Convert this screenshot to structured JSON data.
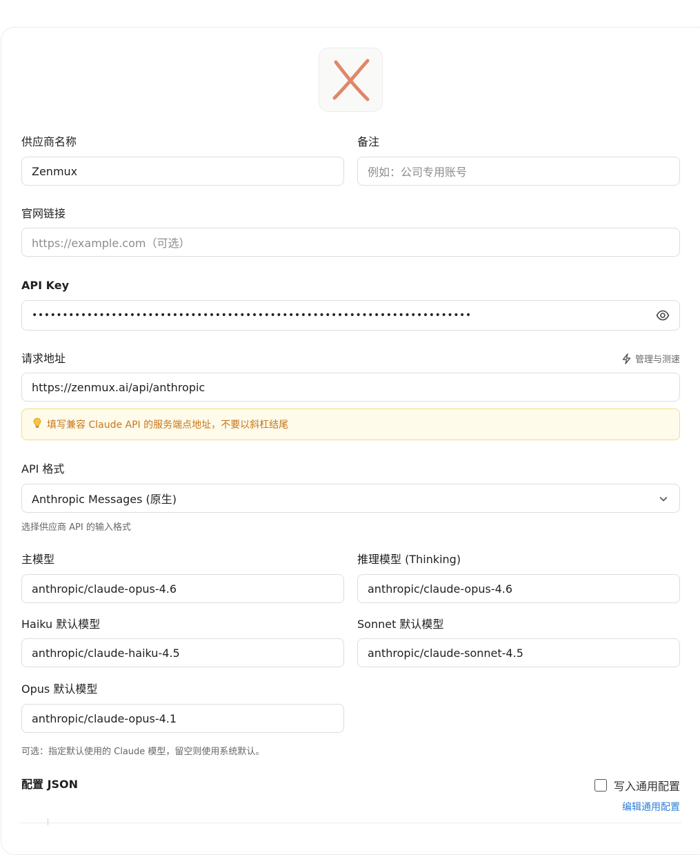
{
  "provider_name": {
    "label": "供应商名称",
    "value": "Zenmux"
  },
  "note": {
    "label": "备注",
    "placeholder": "例如：公司专用账号"
  },
  "website": {
    "label": "官网链接",
    "placeholder": "https://example.com（可选）"
  },
  "api_key": {
    "label": "API Key",
    "masked": "••••••••••••••••••••••••••••••••••••••••••••••••••••••••••••••••••••••••"
  },
  "endpoint": {
    "label": "请求地址",
    "manage_label": "管理与测速",
    "value": "https://zenmux.ai/api/anthropic",
    "hint": "填写兼容 Claude API 的服务端点地址，不要以斜杠结尾"
  },
  "api_format": {
    "label": "API 格式",
    "value": "Anthropic Messages (原生)",
    "helper": "选择供应商 API 的输入格式"
  },
  "models": {
    "main": {
      "label": "主模型",
      "value": "anthropic/claude-opus-4.6"
    },
    "thinking": {
      "label": "推理模型 (Thinking)",
      "value": "anthropic/claude-opus-4.6"
    },
    "haiku": {
      "label": "Haiku 默认模型",
      "value": "anthropic/claude-haiku-4.5"
    },
    "sonnet": {
      "label": "Sonnet 默认模型",
      "value": "anthropic/claude-sonnet-4.5"
    },
    "opus": {
      "label": "Opus 默认模型",
      "value": "anthropic/claude-opus-4.1"
    },
    "helper": "可选：指定默认使用的 Claude 模型，留空则使用系统默认。"
  },
  "config_json": {
    "label": "配置 JSON",
    "write_common_label": "写入通用配置",
    "write_common_checked": false,
    "edit_common_label": "编辑通用配置"
  },
  "colors": {
    "logo": "#e0876a",
    "hint_text": "#c6761a",
    "hint_bg": "#fffbea",
    "link": "#2f7fd6"
  },
  "icons": [
    "provider-logo-icon",
    "eye-icon",
    "lightning-icon",
    "lightbulb-icon",
    "chevron-down-icon"
  ]
}
